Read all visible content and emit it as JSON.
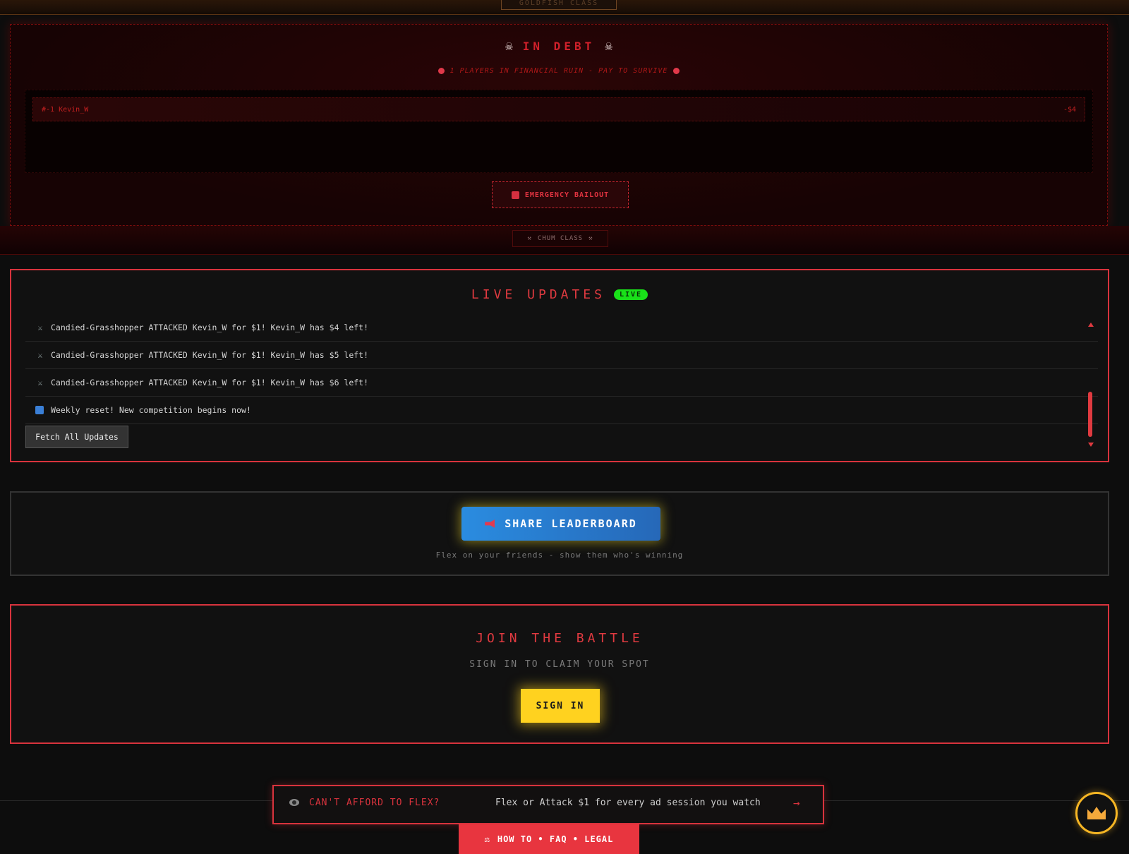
{
  "goldfish_tab": {
    "label": "GOLDFISH CLASS"
  },
  "debt": {
    "title": "IN DEBT",
    "subtitle": "1 PLAYERS IN FINANCIAL RUIN - PAY TO SURVIVE",
    "rows": [
      {
        "rank": "#-1",
        "name": "Kevin_W",
        "amount": "-$4"
      }
    ],
    "bailout_label": "EMERGENCY BAILOUT"
  },
  "chum_tab": {
    "label": "CHUM CLASS"
  },
  "live_updates": {
    "title": "LIVE UPDATES",
    "badge": "LIVE",
    "items": [
      {
        "icon": "crossed-swords-icon",
        "text": "Candied-Grasshopper ATTACKED Kevin_W for $1! Kevin_W has $4 left!"
      },
      {
        "icon": "crossed-swords-icon",
        "text": "Candied-Grasshopper ATTACKED Kevin_W for $1! Kevin_W has $5 left!"
      },
      {
        "icon": "crossed-swords-icon",
        "text": "Candied-Grasshopper ATTACKED Kevin_W for $1! Kevin_W has $6 left!"
      },
      {
        "icon": "refresh-icon",
        "text": "Weekly reset! New competition begins now!"
      }
    ],
    "fetch_label": "Fetch All Updates"
  },
  "share": {
    "button_label": "SHARE LEADERBOARD",
    "subtitle": "Flex on your friends - show them who's winning"
  },
  "join": {
    "title": "JOIN THE BATTLE",
    "subtitle": "SIGN IN TO CLAIM YOUR SPOT",
    "button_label": "SIGN IN"
  },
  "ad_banner": {
    "question": "CAN'T AFFORD TO FLEX?",
    "text": "Flex or Attack $1 for every ad session you watch",
    "arrow": "→"
  },
  "footer_nav": {
    "label": "HOW TO • FAQ • LEGAL"
  },
  "colors": {
    "accent_red": "#e03a40",
    "live_green": "#19e019",
    "signin_yellow": "#ffd21f",
    "share_blue": "#2a8ce0"
  }
}
